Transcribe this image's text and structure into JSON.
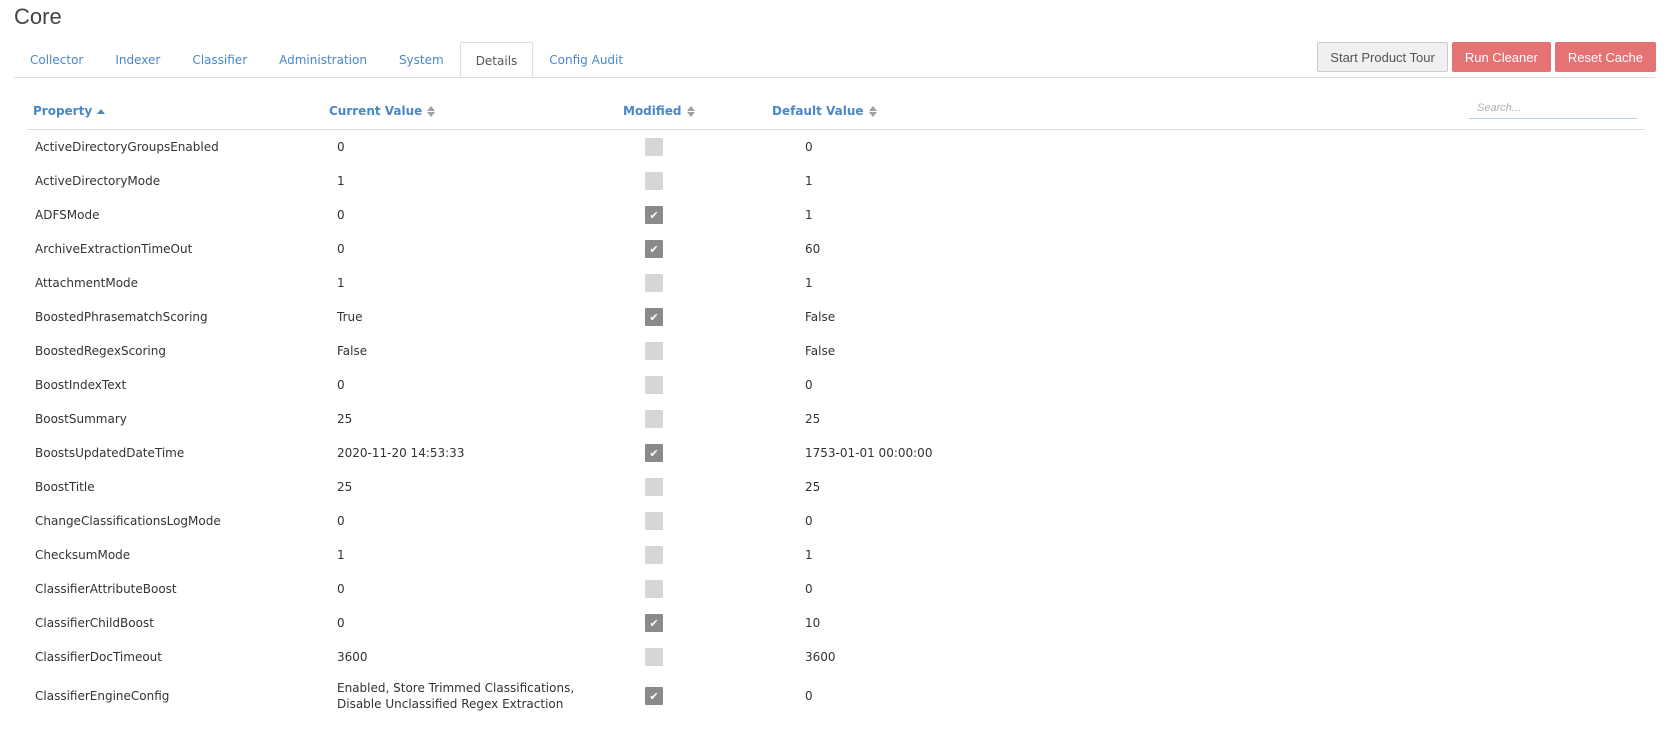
{
  "title": "Core",
  "tabs": [
    {
      "label": "Collector",
      "active": false
    },
    {
      "label": "Indexer",
      "active": false
    },
    {
      "label": "Classifier",
      "active": false
    },
    {
      "label": "Administration",
      "active": false
    },
    {
      "label": "System",
      "active": false
    },
    {
      "label": "Details",
      "active": true
    },
    {
      "label": "Config Audit",
      "active": false
    }
  ],
  "actions": {
    "tour_label": "Start Product Tour",
    "cleaner_label": "Run Cleaner",
    "cache_label": "Reset Cache"
  },
  "table": {
    "columns": {
      "property": "Property",
      "current": "Current Value",
      "modified": "Modified",
      "default": "Default Value"
    },
    "sort": {
      "column": "property",
      "direction": "asc"
    },
    "search_placeholder": "Search...",
    "rows": [
      {
        "property": "ActiveDirectoryGroupsEnabled",
        "current": "0",
        "modified": false,
        "default": "0"
      },
      {
        "property": "ActiveDirectoryMode",
        "current": "1",
        "modified": false,
        "default": "1"
      },
      {
        "property": "ADFSMode",
        "current": "0",
        "modified": true,
        "default": "1"
      },
      {
        "property": "ArchiveExtractionTimeOut",
        "current": "0",
        "modified": true,
        "default": "60"
      },
      {
        "property": "AttachmentMode",
        "current": "1",
        "modified": false,
        "default": "1"
      },
      {
        "property": "BoostedPhrasematchScoring",
        "current": "True",
        "modified": true,
        "default": "False"
      },
      {
        "property": "BoostedRegexScoring",
        "current": "False",
        "modified": false,
        "default": "False"
      },
      {
        "property": "BoostIndexText",
        "current": "0",
        "modified": false,
        "default": "0"
      },
      {
        "property": "BoostSummary",
        "current": "25",
        "modified": false,
        "default": "25"
      },
      {
        "property": "BoostsUpdatedDateTime",
        "current": "2020-11-20 14:53:33",
        "modified": true,
        "default": "1753-01-01 00:00:00"
      },
      {
        "property": "BoostTitle",
        "current": "25",
        "modified": false,
        "default": "25"
      },
      {
        "property": "ChangeClassificationsLogMode",
        "current": "0",
        "modified": false,
        "default": "0"
      },
      {
        "property": "ChecksumMode",
        "current": "1",
        "modified": false,
        "default": "1"
      },
      {
        "property": "ClassifierAttributeBoost",
        "current": "0",
        "modified": false,
        "default": "0"
      },
      {
        "property": "ClassifierChildBoost",
        "current": "0",
        "modified": true,
        "default": "10"
      },
      {
        "property": "ClassifierDocTimeout",
        "current": "3600",
        "modified": false,
        "default": "3600"
      },
      {
        "property": "ClassifierEngineConfig",
        "current": "Enabled, Store Trimmed Classifications, Disable Unclassified Regex Extraction",
        "modified": true,
        "default": "0",
        "multiline": true
      }
    ]
  }
}
